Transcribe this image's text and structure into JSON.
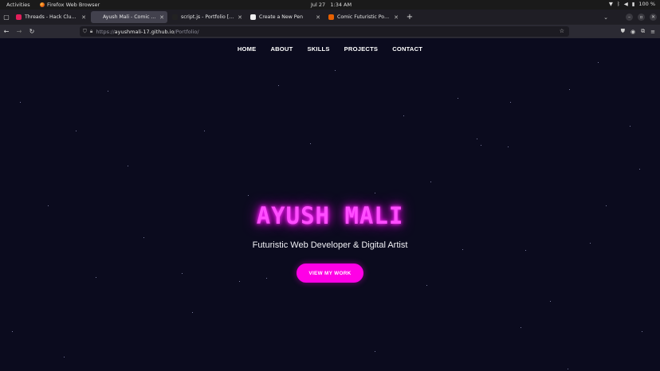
{
  "system": {
    "activities": "Activities",
    "app_name": "Firefox Web Browser",
    "date": "Jul 27",
    "time": "1:34 AM",
    "battery": "100 %"
  },
  "tabs": [
    {
      "title": "Threads - Hack Club - Slack",
      "favicon_color": "#e01e5a",
      "active": false
    },
    {
      "title": "Ayush Mali - Comic Futuristic",
      "favicon_color": "#42414d",
      "active": true
    },
    {
      "title": "script.js - Portfolio [Codespace]",
      "favicon_color": "#222222",
      "active": false
    },
    {
      "title": "Create a New Pen",
      "favicon_color": "#eeeeee",
      "active": false
    },
    {
      "title": "Comic Futuristic Portfolio",
      "favicon_color": "#e66000",
      "active": false
    }
  ],
  "address_bar": {
    "scheme": "https://",
    "host": "ayushmali-17.github.io",
    "path": "/Portfolio/"
  },
  "site": {
    "nav": [
      "HOME",
      "ABOUT",
      "SKILLS",
      "PROJECTS",
      "CONTACT"
    ],
    "hero_title": "AYUSH MALI",
    "hero_subtitle": "Futuristic Web Developer & Digital Artist",
    "cta_label": "VIEW MY WORK"
  },
  "colors": {
    "background": "#0b0b1e",
    "neon_magenta": "#ff00e6",
    "title_glow": "#ff4dff"
  }
}
